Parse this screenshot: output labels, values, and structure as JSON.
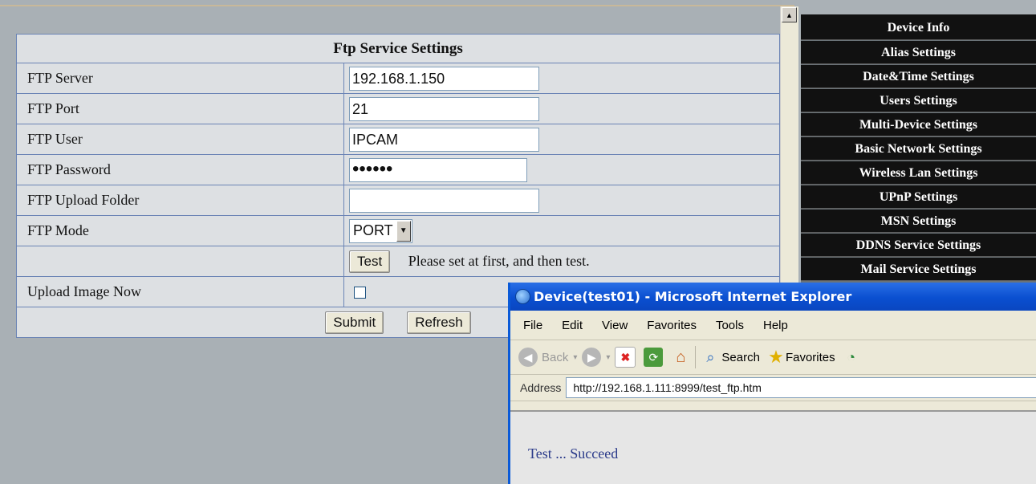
{
  "ftp": {
    "title": "Ftp Service Settings",
    "server_label": "FTP Server",
    "server_value": "192.168.1.150",
    "port_label": "FTP Port",
    "port_value": "21",
    "user_label": "FTP User",
    "user_value": "IPCAM",
    "password_label": "FTP Password",
    "password_value": "••••••",
    "folder_label": "FTP Upload Folder",
    "folder_value": "",
    "mode_label": "FTP Mode",
    "mode_value": "PORT",
    "test_label": "Test",
    "test_message": "Please set at first, and then test.",
    "upload_label": "Upload Image Now",
    "submit_label": "Submit",
    "refresh_label": "Refresh"
  },
  "nav": {
    "items": [
      "Device Info",
      "Alias Settings",
      "Date&Time Settings",
      "Users Settings",
      "Multi-Device Settings",
      "Basic Network Settings",
      "Wireless Lan Settings",
      "UPnP Settings",
      "MSN Settings",
      "DDNS Service Settings",
      "Mail Service Settings"
    ]
  },
  "popup": {
    "title": "Device(test01) - Microsoft Internet Explorer",
    "menu": [
      "File",
      "Edit",
      "View",
      "Favorites",
      "Tools",
      "Help"
    ],
    "back_label": "Back",
    "search_label": "Search",
    "favorites_label": "Favorites",
    "address_label": "Address",
    "url": "http://192.168.1.111:8999/test_ftp.htm",
    "result": "Test ... Succeed"
  },
  "icons": [
    "up-arrow-icon",
    "dropdown-arrow-icon",
    "ie-logo-icon",
    "back-icon",
    "forward-icon",
    "stop-icon",
    "refresh-icon",
    "home-icon",
    "search-icon",
    "favorites-star-icon",
    "media-icon"
  ]
}
